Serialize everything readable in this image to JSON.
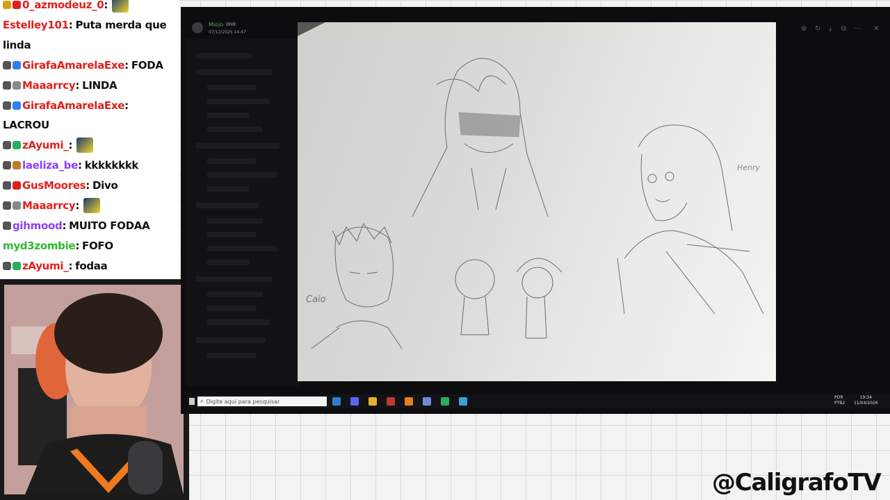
{
  "chat": {
    "messages": [
      {
        "user": "0_azmodeuz_0",
        "user_color": "#e0201e",
        "text": "",
        "badges": [
          "#d4a017",
          "#e0201e"
        ],
        "emote": true
      },
      {
        "user": "Estelley101",
        "user_color": "#e0201e",
        "text": "Puta merda que",
        "badges": [],
        "emote": false
      },
      {
        "user": "",
        "user_color": "#111111",
        "text": "linda",
        "badges": [],
        "emote": false
      },
      {
        "user": "GirafaAmarelaExe",
        "user_color": "#e0201e",
        "text": "FODA",
        "badges": [
          "#555555",
          "#2f80ed"
        ],
        "emote": false
      },
      {
        "user": "Maaarrcy",
        "user_color": "#e0201e",
        "text": "LINDA",
        "badges": [
          "#555555",
          "#888888"
        ],
        "emote": false
      },
      {
        "user": "GirafaAmarelaExe",
        "user_color": "#e0201e",
        "text": "",
        "badges": [
          "#555555",
          "#2f80ed"
        ],
        "emote": false
      },
      {
        "user": "",
        "user_color": "#111111",
        "text": "LACROU",
        "badges": [],
        "emote": false
      },
      {
        "user": "zAyumi_",
        "user_color": "#e0201e",
        "text": "",
        "badges": [
          "#555555",
          "#27ae60"
        ],
        "emote": true
      },
      {
        "user": "laeliza_be",
        "user_color": "#8a3ffc",
        "text": "kkkkkkkk",
        "badges": [
          "#555555",
          "#c07a2c"
        ],
        "emote": false
      },
      {
        "user": "GusMoores",
        "user_color": "#e0201e",
        "text": "Divo",
        "badges": [
          "#555555",
          "#e0201e"
        ],
        "emote": false
      },
      {
        "user": "Maaarrcy",
        "user_color": "#e0201e",
        "text": "",
        "badges": [
          "#555555",
          "#888888"
        ],
        "emote": true
      },
      {
        "user": "gihmood",
        "user_color": "#8a3ffc",
        "text": "MUITO FODAA",
        "badges": [
          "#555555"
        ],
        "emote": false
      },
      {
        "user": "myd3zombie",
        "user_color": "#2eb82e",
        "text": "FOFO",
        "badges": [],
        "emote": false
      },
      {
        "user": "zAyumi_",
        "user_color": "#e0201e",
        "text": "fodaa",
        "badges": [
          "#555555",
          "#27ae60"
        ],
        "emote": false
      }
    ]
  },
  "discord": {
    "username": "Miojo",
    "tag": "DIVE",
    "timestamp": "07/12/2025 14:47"
  },
  "sketch_labels": {
    "left_name": "Caio",
    "right_name": "Henry"
  },
  "taskbar": {
    "search_placeholder": "Digite aqui para pesquisar",
    "lang": "POR",
    "lang_sub": "PTB2",
    "time": "19:34",
    "date": "11/04/2026"
  },
  "watermark": "@CaligrafoTV",
  "colors": {
    "accent_red": "#e0201e",
    "accent_purple": "#8a3ffc",
    "accent_green": "#2eb82e"
  },
  "icons": [
    "zoom-in-icon",
    "rotate-icon",
    "download-icon",
    "open-external-icon",
    "more-icon",
    "close-icon",
    "windows-icon",
    "search-icon"
  ]
}
